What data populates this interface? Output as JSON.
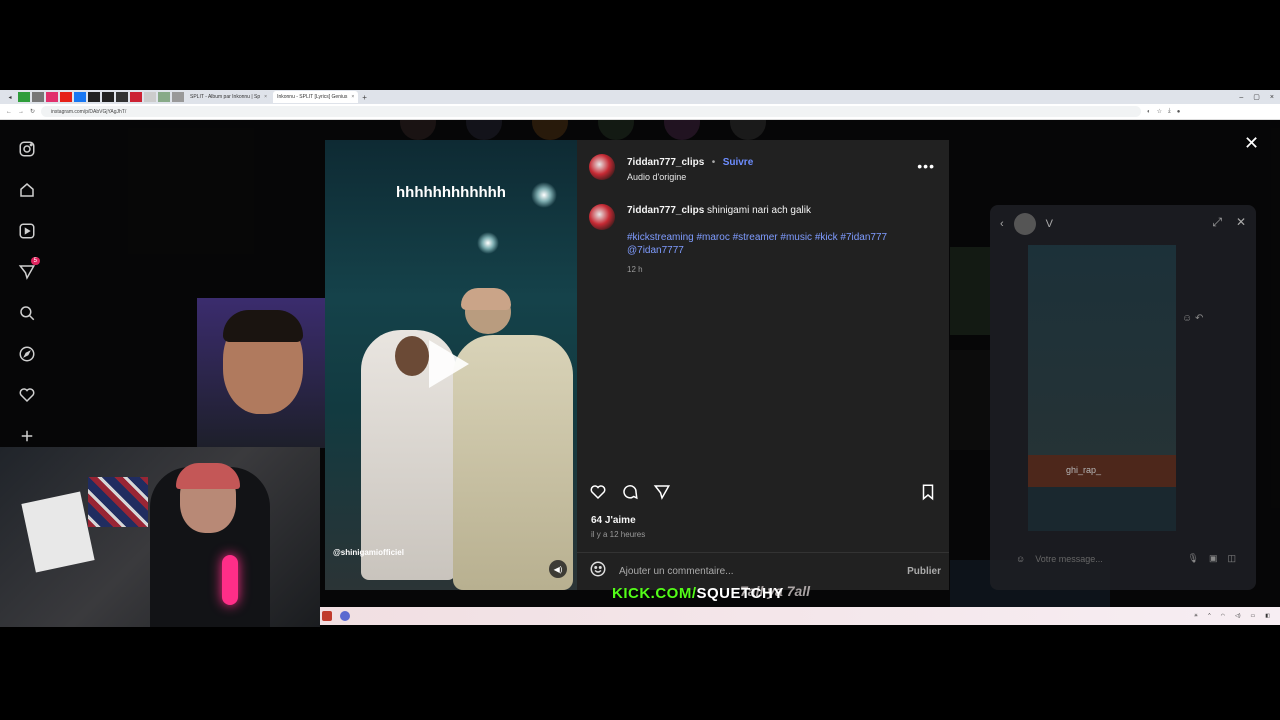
{
  "browser": {
    "tabs": [
      {
        "label": "SPLIT - Album par Inkonnu | Sp"
      },
      {
        "label": "Inkonnu - SPLIT [Lyrics] Genius"
      }
    ],
    "url": "instagram.com/p/DAbVGjYAgJhT/"
  },
  "sidebar": {
    "items": [
      {
        "name": "instagram",
        "label": "Instagram"
      },
      {
        "name": "home",
        "label": "Accueil"
      },
      {
        "name": "reels",
        "label": "Reels"
      },
      {
        "name": "messages",
        "label": "Messages",
        "badge": "5"
      },
      {
        "name": "search",
        "label": "Recherche"
      },
      {
        "name": "explore",
        "label": "Découvrir"
      },
      {
        "name": "notifications",
        "label": "Notifications"
      },
      {
        "name": "create",
        "label": "Créer"
      }
    ]
  },
  "post": {
    "video_overlay_text": "hhhhhhhhhhhh",
    "watermark": "@shinigamiofficiel",
    "username": "7iddan777_clips",
    "follow": "Suivre",
    "audio": "Audio d'origine",
    "caption_user": "7iddan777_clips",
    "caption_text": "shinigami nari ach galik",
    "hashtags": "#kickstreaming #maroc #streamer #music #kick #7idan777",
    "mention": "@7idan7777",
    "caption_time": "12 h",
    "likes": "64 J'aime",
    "posted_ago": "il y a 12 heures",
    "comment_placeholder": "Ajouter un commentaire...",
    "publish": "Publier"
  },
  "messenger": {
    "contact": "V",
    "shared_user": "ghi_rap_",
    "input_placeholder": "Votre message..."
  },
  "stream": {
    "kick_prefix": "KICK.COM/",
    "kick_channel": "SQUETCHY",
    "bg_text": "7all ya 7all"
  },
  "colors": {
    "accent_link": "#6d8dff",
    "hashtag": "#7f9cff",
    "kick_green": "#53fc18"
  }
}
